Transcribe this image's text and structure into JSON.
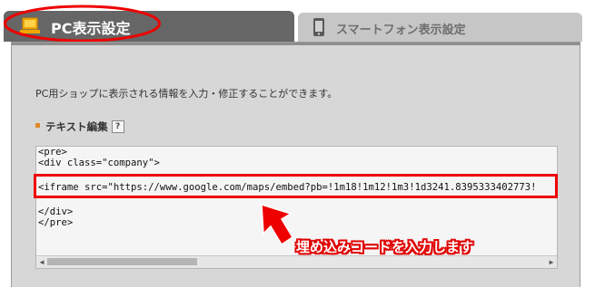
{
  "tabs": {
    "pc": {
      "label": "PC表示設定",
      "icon": "laptop-icon"
    },
    "smartphone": {
      "label": "スマートフォン表示設定",
      "icon": "smartphone-icon"
    }
  },
  "panel": {
    "info_text": "PC用ショップに表示される情報を入力・修正することができます。",
    "section_title": "テキスト編集",
    "help_label": "?"
  },
  "editor": {
    "lines": [
      "<pre>",
      "<div class=\"company\">",
      "",
      "<iframe src=\"https://www.google.com/maps/embed?pb=!1m18!1m12!1m3!1d3241.8395333402773!",
      "",
      "</div>",
      "</pre>"
    ]
  },
  "annotation": {
    "callout_text": "埋め込みコードを入力します",
    "highlight_color": "#ee0000"
  }
}
